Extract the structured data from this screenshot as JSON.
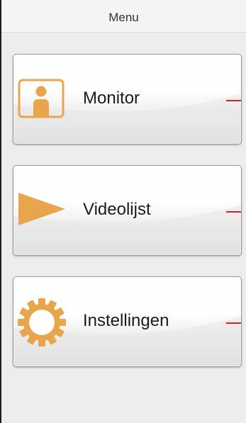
{
  "header": {
    "title": "Menu"
  },
  "menu": {
    "items": [
      {
        "label": "Monitor",
        "icon": "person-icon"
      },
      {
        "label": "Videolijst",
        "icon": "play-icon"
      },
      {
        "label": "Instellingen",
        "icon": "gear-icon"
      }
    ]
  },
  "colors": {
    "icon_accent": "#E8A54B",
    "indicator": "#D8222A",
    "frame": "#1C1C1C"
  }
}
